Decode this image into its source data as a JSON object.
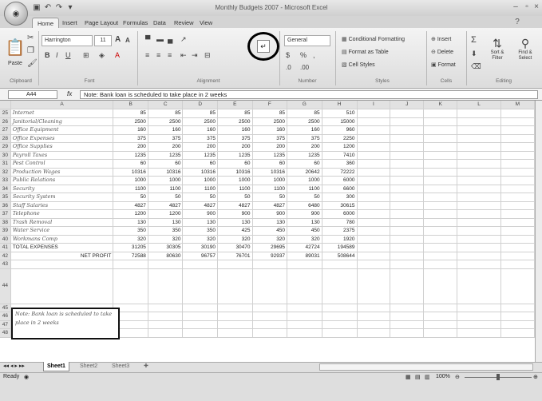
{
  "window": {
    "title": "Monthly Budgets 2007 - Microsoft Excel"
  },
  "tabs": [
    "Home",
    "Insert",
    "Page Layout",
    "Formulas",
    "Data",
    "Review",
    "View"
  ],
  "ribbon": {
    "clipboard": {
      "paste": "Paste",
      "label": "Clipboard"
    },
    "font": {
      "name": "Harrington",
      "size": "11",
      "label": "Font"
    },
    "alignment": {
      "label": "Alignment"
    },
    "number": {
      "format": "General",
      "currency": "$",
      "percent": "%",
      "label": "Number"
    },
    "styles": {
      "conditional": "Conditional Formatting",
      "table": "Format as Table",
      "cell": "Cell Styles",
      "label": "Styles"
    },
    "cells": {
      "insert": "Insert",
      "delete": "Delete",
      "format": "Format",
      "label": "Cells"
    },
    "editing": {
      "sum": "Σ",
      "sort": "Sort & Filter",
      "find": "Find & Select",
      "label": "Editing"
    }
  },
  "formula": {
    "cell_ref": "A44",
    "fx": "fx",
    "content": "Note: Bank loan is scheduled to take place in 2 weeks"
  },
  "columns": [
    "A",
    "B",
    "C",
    "D",
    "E",
    "F",
    "G",
    "H",
    "I",
    "J",
    "K",
    "L",
    "M"
  ],
  "rows": [
    {
      "n": "25",
      "label": "Internet",
      "v": [
        "85",
        "85",
        "85",
        "85",
        "85",
        "85",
        "510"
      ]
    },
    {
      "n": "26",
      "label": "Janitorial/Cleaning",
      "v": [
        "2500",
        "2500",
        "2500",
        "2500",
        "2500",
        "2500",
        "15000"
      ]
    },
    {
      "n": "27",
      "label": "Office Equipment",
      "v": [
        "160",
        "160",
        "160",
        "160",
        "160",
        "160",
        "960"
      ]
    },
    {
      "n": "28",
      "label": "Office Expenses",
      "v": [
        "375",
        "375",
        "375",
        "375",
        "375",
        "375",
        "2250"
      ]
    },
    {
      "n": "29",
      "label": "Office Supplies",
      "v": [
        "200",
        "200",
        "200",
        "200",
        "200",
        "200",
        "1200"
      ]
    },
    {
      "n": "30",
      "label": "Payroll Taxes",
      "v": [
        "1235",
        "1235",
        "1235",
        "1235",
        "1235",
        "1235",
        "7410"
      ]
    },
    {
      "n": "31",
      "label": "Pest Control",
      "v": [
        "60",
        "60",
        "60",
        "60",
        "60",
        "60",
        "360"
      ]
    },
    {
      "n": "32",
      "label": "Production Wages",
      "v": [
        "10316",
        "10316",
        "10316",
        "10316",
        "10316",
        "20642",
        "72222"
      ]
    },
    {
      "n": "33",
      "label": "Public Relations",
      "v": [
        "1000",
        "1000",
        "1000",
        "1000",
        "1000",
        "1000",
        "6000"
      ]
    },
    {
      "n": "34",
      "label": "Security",
      "v": [
        "1100",
        "1100",
        "1100",
        "1100",
        "1100",
        "1100",
        "6600"
      ]
    },
    {
      "n": "35",
      "label": "Security System",
      "v": [
        "50",
        "50",
        "50",
        "50",
        "50",
        "50",
        "300"
      ]
    },
    {
      "n": "36",
      "label": "Staff Salaries",
      "v": [
        "4827",
        "4827",
        "4827",
        "4827",
        "4827",
        "6480",
        "30615"
      ]
    },
    {
      "n": "37",
      "label": "Telephone",
      "v": [
        "1200",
        "1200",
        "900",
        "900",
        "900",
        "900",
        "6000"
      ]
    },
    {
      "n": "38",
      "label": "Trash Removal",
      "v": [
        "130",
        "130",
        "130",
        "130",
        "130",
        "130",
        "780"
      ]
    },
    {
      "n": "39",
      "label": "Water Service",
      "v": [
        "350",
        "350",
        "350",
        "425",
        "450",
        "450",
        "2375"
      ]
    },
    {
      "n": "40",
      "label": "Workmans Comp",
      "v": [
        "320",
        "320",
        "320",
        "320",
        "320",
        "320",
        "1920"
      ]
    },
    {
      "n": "41",
      "label": "TOTAL EXPENSES",
      "v": [
        "31205",
        "30305",
        "30190",
        "30470",
        "29695",
        "42724",
        "194589"
      ]
    },
    {
      "n": "42",
      "label": "NET PROFIT",
      "v": [
        "72588",
        "80630",
        "96757",
        "76701",
        "92937",
        "89031",
        "508644"
      ]
    },
    {
      "n": "43",
      "label": "",
      "v": [
        "",
        "",
        "",
        "",
        "",
        "",
        ""
      ]
    }
  ],
  "empty_rows": [
    "44",
    "45",
    "46",
    "47",
    "48"
  ],
  "note": "Note: Bank loan is scheduled to take place in 2 weeks",
  "sheets": [
    "Sheet1",
    "Sheet2",
    "Sheet3"
  ],
  "status": {
    "ready": "Ready",
    "zoom": "100%"
  }
}
